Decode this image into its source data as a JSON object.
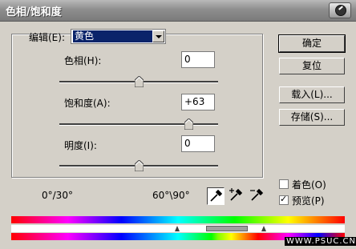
{
  "window": {
    "title": "色相/饱和度",
    "close_icon": "help-circle-icon"
  },
  "edit": {
    "label": "编辑(E):",
    "selected": "黄色"
  },
  "sliders": {
    "hue": {
      "label": "色相(H):",
      "value": "0",
      "level": 0.5
    },
    "saturation": {
      "label": "饱和度(A):",
      "value": "+63",
      "level": 0.815
    },
    "lightness": {
      "label": "明度(I):",
      "value": "0",
      "level": 0.5
    }
  },
  "buttons": {
    "ok": "确定",
    "reset": "复位",
    "load": "载入(L)...",
    "save": "存储(S)..."
  },
  "options": {
    "colorize": {
      "label": "着色(O)",
      "checked": false
    },
    "preview": {
      "label": "预览(P)",
      "checked": true
    }
  },
  "range": {
    "left": "0°/30°",
    "right": "60°\\90°"
  },
  "watermark": "WWW.PSUC.CN",
  "tools": [
    "eyedropper-icon",
    "eyedropper-plus-icon",
    "eyedropper-minus-icon"
  ]
}
